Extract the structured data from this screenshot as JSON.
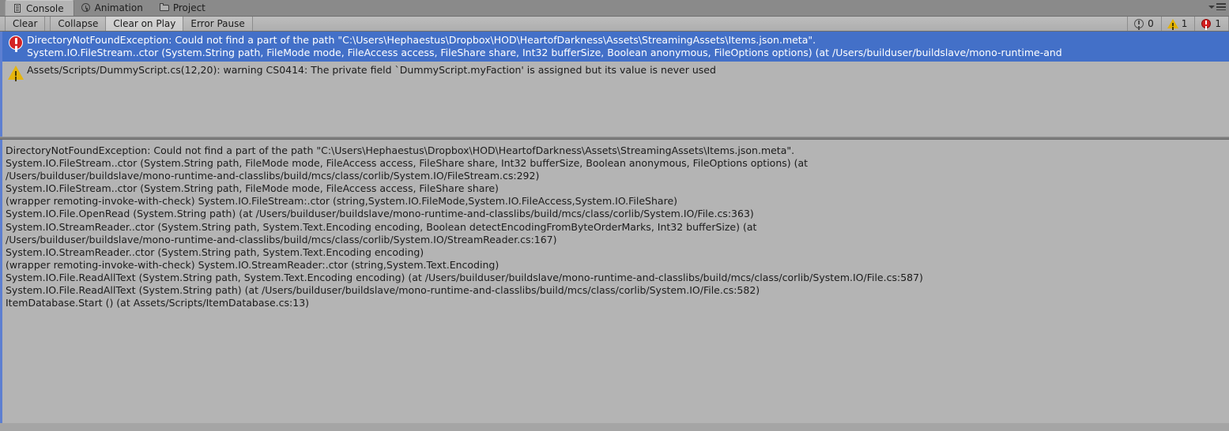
{
  "window": {
    "title": "Console"
  },
  "tabs": [
    {
      "label": "Console",
      "icon": "console-icon",
      "active": true
    },
    {
      "label": "Animation",
      "icon": "clock-icon",
      "active": false
    },
    {
      "label": "Project",
      "icon": "folder-icon",
      "active": false
    }
  ],
  "tab_menu": {
    "dropdown_icon": "chevron-down-icon",
    "menu_icon": "hamburger-menu-icon"
  },
  "toolbar": {
    "clear_label": "Clear",
    "collapse_label": "Collapse",
    "clear_on_play_label": "Clear on Play",
    "error_pause_label": "Error Pause",
    "counters": [
      {
        "icon": "info-icon",
        "count": "0"
      },
      {
        "icon": "warning-icon",
        "count": "1"
      },
      {
        "icon": "error-icon",
        "count": "1"
      }
    ]
  },
  "log_list": [
    {
      "type": "error",
      "icon": "error-icon",
      "selected": true,
      "line1": "DirectoryNotFoundException: Could not find a part of the path \"C:\\Users\\Hephaestus\\Dropbox\\HOD\\HeartofDarkness\\Assets\\StreamingAssets\\Items.json.meta\".",
      "line2": "System.IO.FileStream..ctor (System.String path, FileMode mode, FileAccess access, FileShare share, Int32 bufferSize, Boolean anonymous, FileOptions options) (at /Users/builduser/buildslave/mono-runtime-and"
    },
    {
      "type": "warning",
      "icon": "warning-icon",
      "selected": false,
      "line1": "Assets/Scripts/DummyScript.cs(12,20): warning CS0414: The private field `DummyScript.myFaction' is assigned but its value is never used",
      "line2": ""
    }
  ],
  "detail": {
    "lines": [
      "DirectoryNotFoundException: Could not find a part of the path \"C:\\Users\\Hephaestus\\Dropbox\\HOD\\HeartofDarkness\\Assets\\StreamingAssets\\Items.json.meta\".",
      "System.IO.FileStream..ctor (System.String path, FileMode mode, FileAccess access, FileShare share, Int32 bufferSize, Boolean anonymous, FileOptions options) (at",
      "/Users/builduser/buildslave/mono-runtime-and-classlibs/build/mcs/class/corlib/System.IO/FileStream.cs:292)",
      "System.IO.FileStream..ctor (System.String path, FileMode mode, FileAccess access, FileShare share)",
      "(wrapper remoting-invoke-with-check) System.IO.FileStream:.ctor (string,System.IO.FileMode,System.IO.FileAccess,System.IO.FileShare)",
      "System.IO.File.OpenRead (System.String path) (at /Users/builduser/buildslave/mono-runtime-and-classlibs/build/mcs/class/corlib/System.IO/File.cs:363)",
      "System.IO.StreamReader..ctor (System.String path, System.Text.Encoding encoding, Boolean detectEncodingFromByteOrderMarks, Int32 bufferSize) (at",
      "/Users/builduser/buildslave/mono-runtime-and-classlibs/build/mcs/class/corlib/System.IO/StreamReader.cs:167)",
      "System.IO.StreamReader..ctor (System.String path, System.Text.Encoding encoding)",
      "(wrapper remoting-invoke-with-check) System.IO.StreamReader:.ctor (string,System.Text.Encoding)",
      "System.IO.File.ReadAllText (System.String path, System.Text.Encoding encoding) (at /Users/builduser/buildslave/mono-runtime-and-classlibs/build/mcs/class/corlib/System.IO/File.cs:587)",
      "System.IO.File.ReadAllText (System.String path) (at /Users/builduser/buildslave/mono-runtime-and-classlibs/build/mcs/class/corlib/System.IO/File.cs:582)",
      "ItemDatabase.Start () (at Assets/Scripts/ItemDatabase.cs:13)"
    ]
  },
  "colors": {
    "selection_blue": "#4370c8",
    "accent_blue": "#5d7fd1",
    "error_red": "#d42222",
    "warning_yellow": "#e5b50d",
    "panel_gray": "#b4b4b4",
    "toolbar_gray": "#b5b5b5"
  }
}
